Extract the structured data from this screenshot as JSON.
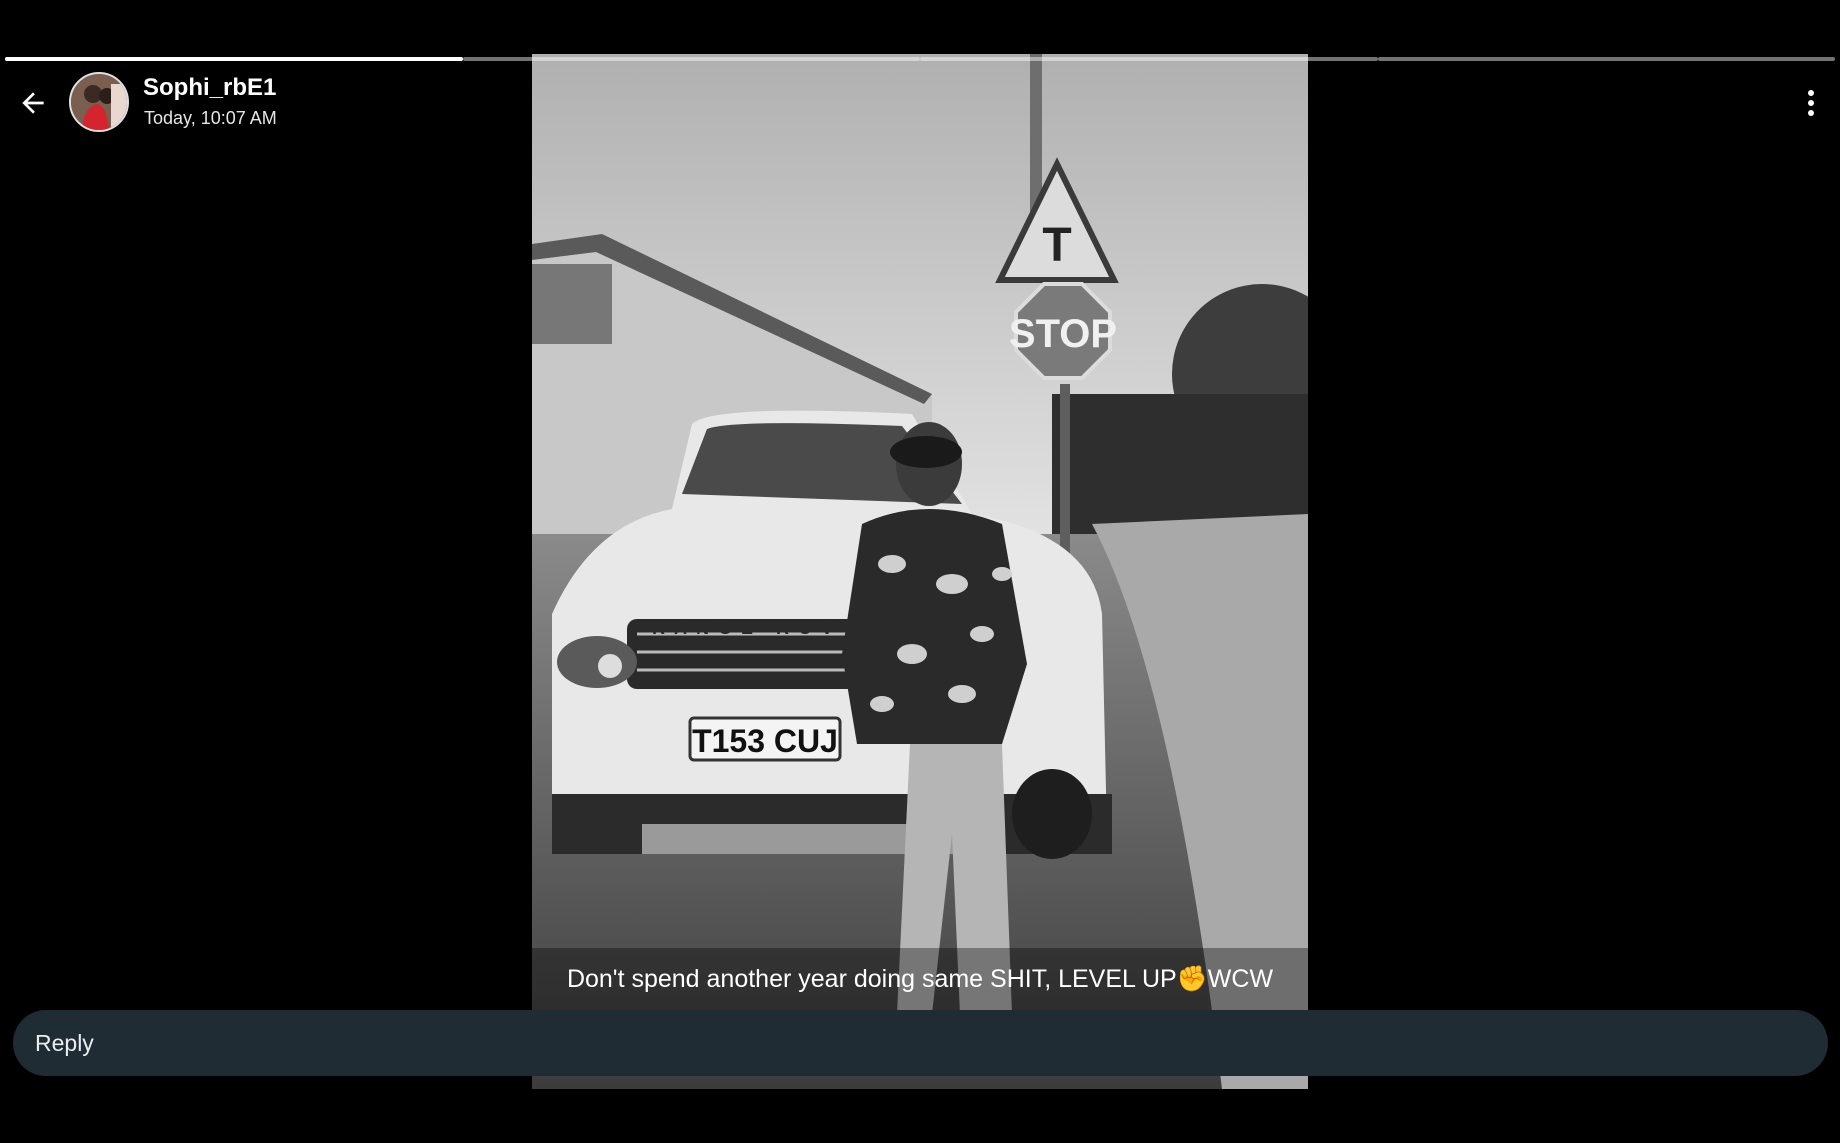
{
  "story": {
    "progress_segments": [
      {
        "index": 1,
        "fill_fraction": 1.0
      },
      {
        "index": 2,
        "fill_fraction": 0.0
      },
      {
        "index": 3,
        "fill_fraction": 0.0
      },
      {
        "index": 4,
        "fill_fraction": 0.0
      }
    ]
  },
  "header": {
    "user_name": "Sophi_rbE1",
    "timestamp": "Today, 10:07 AM",
    "back_icon": "arrow-left-icon",
    "more_icon": "more-vertical-icon"
  },
  "photo": {
    "plate_text": "T153 CUJ",
    "brand_text": "RANGE ROV",
    "stop_sign_text": "STOP",
    "warning_sign_text": "T"
  },
  "caption": {
    "text": "Don't spend another year doing same SHIT, LEVEL UP✊WCW"
  },
  "reply": {
    "placeholder": "Reply"
  },
  "colors": {
    "background": "#000000",
    "reply_bar": "#1f2c33",
    "progress_active": "#ffffff"
  }
}
